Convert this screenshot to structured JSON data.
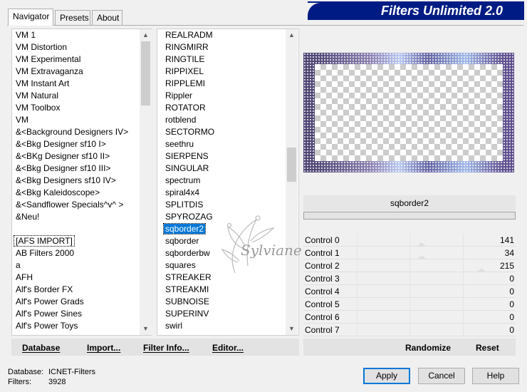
{
  "window": {
    "title": "Filters Unlimited 2.0"
  },
  "tabs": [
    {
      "label": "Navigator",
      "active": true
    },
    {
      "label": "Presets",
      "active": false
    },
    {
      "label": "About",
      "active": false
    }
  ],
  "categories": {
    "items_top": [
      "VM 1",
      "VM Distortion",
      "VM Experimental",
      "VM Extravaganza",
      "VM Instant Art",
      "VM Natural",
      "VM Toolbox",
      "VM",
      "&<Background Designers IV>",
      "&<Bkg Designer sf10 I>",
      "&<BKg Designer sf10 II>",
      "&<Bkg Designer sf10 III>",
      "&<Bkg Designers sf10 IV>",
      "&<Bkg Kaleidoscope>",
      "&<Sandflower Specials^v^ >",
      "&Neu!"
    ],
    "items_bottom": [
      "[AFS IMPORT]",
      "AB Filters 2000",
      "a",
      "AFH",
      "Alf's Border FX",
      "Alf's Power Grads",
      "Alf's Power Sines",
      "Alf's Power Toys"
    ],
    "focused": "[AFS IMPORT]"
  },
  "filters": {
    "items": [
      "REALRADM",
      "RINGMIRR",
      "RINGTILE",
      "RIPPIXEL",
      "RIPPLEMI",
      "Rippler",
      "ROTATOR",
      "rotblend",
      "SECTORMO",
      "seethru",
      "SIERPENS",
      "SINGULAR",
      "spectrum",
      "spiral4x4",
      "SPLITDIS",
      "SPYROZAG",
      "sqborder2",
      "sqborder",
      "sqborderbw",
      "squares",
      "STREAKER",
      "STREAKMI",
      "SUBNOISE",
      "SUPERINV",
      "swirl"
    ],
    "selected": "sqborder2"
  },
  "preview": {
    "filter_name": "sqborder2",
    "frame_colors": [
      "#4a4070",
      "#8a7fb0",
      "#b8c8f0",
      "#6060a0",
      "#9fb8e8"
    ]
  },
  "controls": [
    {
      "label": "Control 0",
      "value": "141"
    },
    {
      "label": "Control 1",
      "value": "34"
    },
    {
      "label": "Control 2",
      "value": "215"
    },
    {
      "label": "Control 3",
      "value": "0"
    },
    {
      "label": "Control 4",
      "value": "0"
    },
    {
      "label": "Control 5",
      "value": "0"
    },
    {
      "label": "Control 6",
      "value": "0"
    },
    {
      "label": "Control 7",
      "value": "0"
    }
  ],
  "toolbar": {
    "database": "Database",
    "import": "Import...",
    "filter_info": "Filter Info...",
    "editor": "Editor...",
    "randomize": "Randomize",
    "reset": "Reset"
  },
  "status": {
    "database_label": "Database:",
    "database_value": "ICNET-Filters",
    "filters_label": "Filters:",
    "filters_value": "3928"
  },
  "buttons": {
    "apply": "Apply",
    "cancel": "Cancel",
    "help": "Help"
  },
  "watermark": {
    "text": "Sylviane"
  },
  "colors": {
    "banner": "#001c84",
    "selection": "#0078d7",
    "dialog_bg": "#f0f0f0"
  }
}
